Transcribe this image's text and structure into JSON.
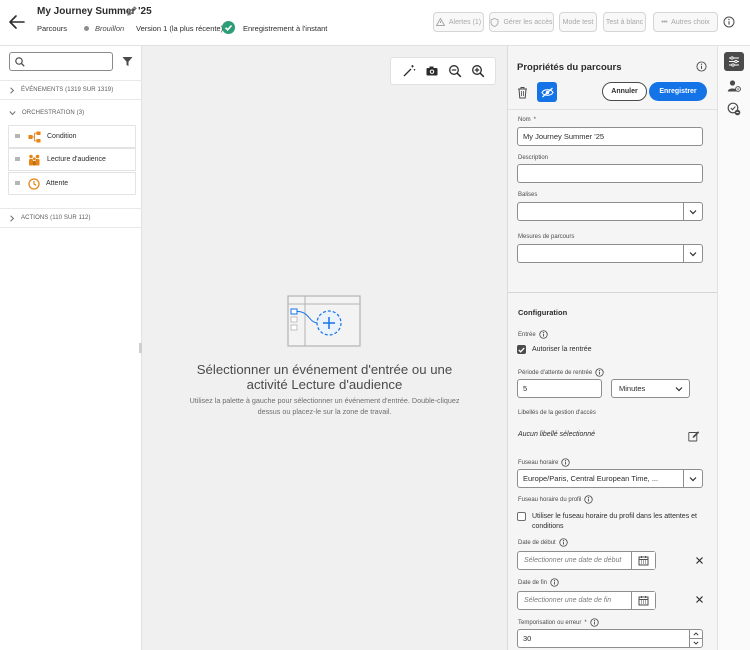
{
  "header": {
    "title": "My Journey Summer '25",
    "breadcrumb": "Parcours",
    "status": "Brouillon",
    "version": "Version 1 (la plus récente)",
    "autosave": "Enregistrement à l'instant",
    "buttons": {
      "alerts": "Alertes (1)",
      "access": "Gérer les accès",
      "test_mode": "Mode test",
      "dry_run": "Test à blanc",
      "more": "Autres choix"
    }
  },
  "palette": {
    "search_placeholder": "",
    "sections": {
      "events": "ÉVÉNEMENTS (1319 SUR 1319)",
      "orchestration": "ORCHESTRATION (3)",
      "actions": "ACTIONS (110 SUR 112)"
    },
    "orchestration_items": [
      {
        "label": "Condition",
        "icon": "condition-icon"
      },
      {
        "label": "Lecture d'audience",
        "icon": "read-audience-icon"
      },
      {
        "label": "Attente",
        "icon": "wait-clock-icon"
      }
    ]
  },
  "canvas": {
    "empty_title": "Sélectionner un événement d'entrée ou une activité Lecture d'audience",
    "empty_desc": "Utilisez la palette à gauche pour sélectionner un événement d'entrée. Double-cliquez dessus ou placez-le sur la zone de travail."
  },
  "properties": {
    "title": "Propriétés du parcours",
    "cancel": "Annuler",
    "save": "Enregistrer",
    "name_label": "Nom",
    "name_required": "*",
    "name_value": "My Journey Summer '25",
    "description_label": "Description",
    "description_value": "",
    "tags_label": "Balises",
    "tags_value": "",
    "metrics_label": "Mesures de parcours",
    "metrics_value": "",
    "config_title": "Configuration",
    "entry_label": "Entrée",
    "reentry_label": "Autoriser la rentrée",
    "reentry_checked": true,
    "wait_period_label": "Période d'attente de rentrée",
    "wait_period_value": "5",
    "wait_period_unit": "Minutes",
    "access_labels_label": "Libellés de la gestion d'accès",
    "access_labels_value": "Aucun libellé sélectionné",
    "timezone_label": "Fuseau horaire",
    "timezone_value": "Europe/Paris, Central European Time, ...",
    "profile_tz_label": "Fuseau horaire du profil",
    "profile_tz_checkbox": "Utiliser le fuseau horaire du profil dans les attentes et conditions",
    "profile_tz_checked": false,
    "start_date_label": "Date de début",
    "start_date_placeholder": "Sélectionner une date de début",
    "end_date_label": "Date de fin",
    "end_date_placeholder": "Sélectionner une date de fin",
    "timeout_label": "Temporisation ou erreur",
    "timeout_required": "*",
    "timeout_value": "30"
  },
  "colors": {
    "accent": "#1473e6",
    "success": "#2d9d78",
    "orchestration_icon": "#e68619"
  }
}
